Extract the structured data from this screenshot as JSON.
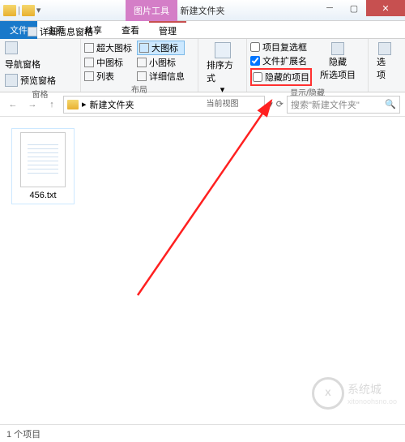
{
  "window": {
    "title": "新建文件夹",
    "contextual_tab": "图片工具"
  },
  "tabs": {
    "file": "文件",
    "home": "主页",
    "share": "共享",
    "view": "查看",
    "manage": "管理"
  },
  "ribbon": {
    "panes": {
      "nav_pane": "导航窗格",
      "preview_pane": "预览窗格",
      "details_pane": "详细信息窗格",
      "group_label": "窗格"
    },
    "layout": {
      "xl_icons": "超大图标",
      "lg_icons": "大图标",
      "md_icons": "中图标",
      "sm_icons": "小图标",
      "list": "列表",
      "details": "详细信息",
      "group_label": "布局"
    },
    "sort": {
      "sort_by": "排序方式",
      "group_label": "当前视图"
    },
    "show_hide": {
      "item_checkboxes": "项目复选框",
      "file_ext": "文件扩展名",
      "hidden_items": "隐藏的项目",
      "hide_sel": "隐藏",
      "hide_sel2": "所选项目",
      "group_label": "显示/隐藏"
    },
    "options": {
      "label": "选项"
    }
  },
  "address": {
    "folder": "新建文件夹",
    "search_placeholder": "搜索\"新建文件夹\""
  },
  "files": [
    {
      "name": "456.txt"
    }
  ],
  "status": {
    "count": "1 个项目"
  },
  "watermark": {
    "brand": "系统城",
    "url": "xitonoohsno.oo"
  }
}
